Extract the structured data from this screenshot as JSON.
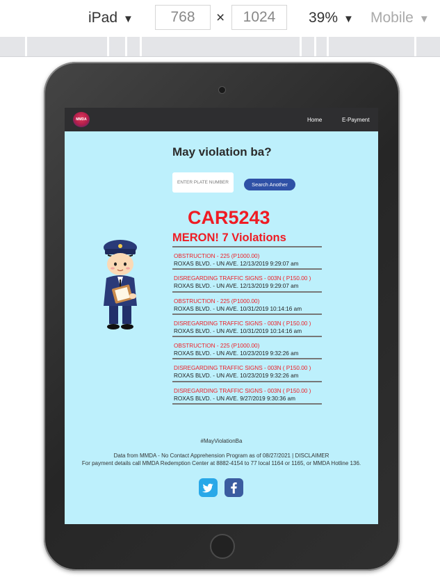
{
  "toolbar": {
    "device": "iPad",
    "width": "768",
    "times": "×",
    "height": "1024",
    "zoom": "39%",
    "mode": "Mobile",
    "caret": "▼"
  },
  "site": {
    "logo_text": "MMDA",
    "nav": [
      {
        "label": "Home"
      },
      {
        "label": "E-Payment"
      }
    ]
  },
  "search": {
    "heading": "May violation ba?",
    "placeholder": "ENTER PLATE NUMBER",
    "button": "Search Another"
  },
  "result": {
    "plate": "CAR5243",
    "summary": "MERON! 7 Violations",
    "violations": [
      {
        "title": "OBSTRUCTION - 225 (P1000.00)",
        "location": "ROXAS BLVD. - UN AVE. 12/13/2019 9:29:07 am"
      },
      {
        "title": "DISREGARDING TRAFFIC SIGNS - 003N ( P150.00 )",
        "location": "ROXAS BLVD. - UN AVE. 12/13/2019 9:29:07 am"
      },
      {
        "title": "OBSTRUCTION - 225 (P1000.00)",
        "location": "ROXAS BLVD. - UN AVE. 10/31/2019 10:14:16 am"
      },
      {
        "title": "DISREGARDING TRAFFIC SIGNS - 003N ( P150.00 )",
        "location": "ROXAS BLVD. - UN AVE. 10/31/2019 10:14:16 am"
      },
      {
        "title": "OBSTRUCTION - 225 (P1000.00)",
        "location": "ROXAS BLVD. - UN AVE. 10/23/2019 9:32:26 am"
      },
      {
        "title": "DISREGARDING TRAFFIC SIGNS - 003N ( P150.00 )",
        "location": "ROXAS BLVD. - UN AVE. 10/23/2019 9:32:26 am"
      },
      {
        "title": "DISREGARDING TRAFFIC SIGNS - 003N ( P150.00 )",
        "location": "ROXAS BLVD. - UN AVE. 9/27/2019 9:30:36 am"
      }
    ]
  },
  "footer": {
    "hashtag": "#MayViolationBa",
    "line1": "Data from MMDA - No Contact Apprehension Program as of 08/27/2021 | DISCLAIMER",
    "line2": "For payment details call MMDA Redemption Center at 8882-4154 to 77 local 1164 or 1165, or MMDA Hotline 136.",
    "social": [
      "twitter-icon",
      "facebook-icon"
    ]
  },
  "colors": {
    "screen_bg": "#bdf0fc",
    "navbar": "#2e2e30",
    "accent_red": "#ef1c24",
    "button_blue": "#2f51a6",
    "twitter": "#29a8e8",
    "facebook": "#3b5ca0"
  }
}
